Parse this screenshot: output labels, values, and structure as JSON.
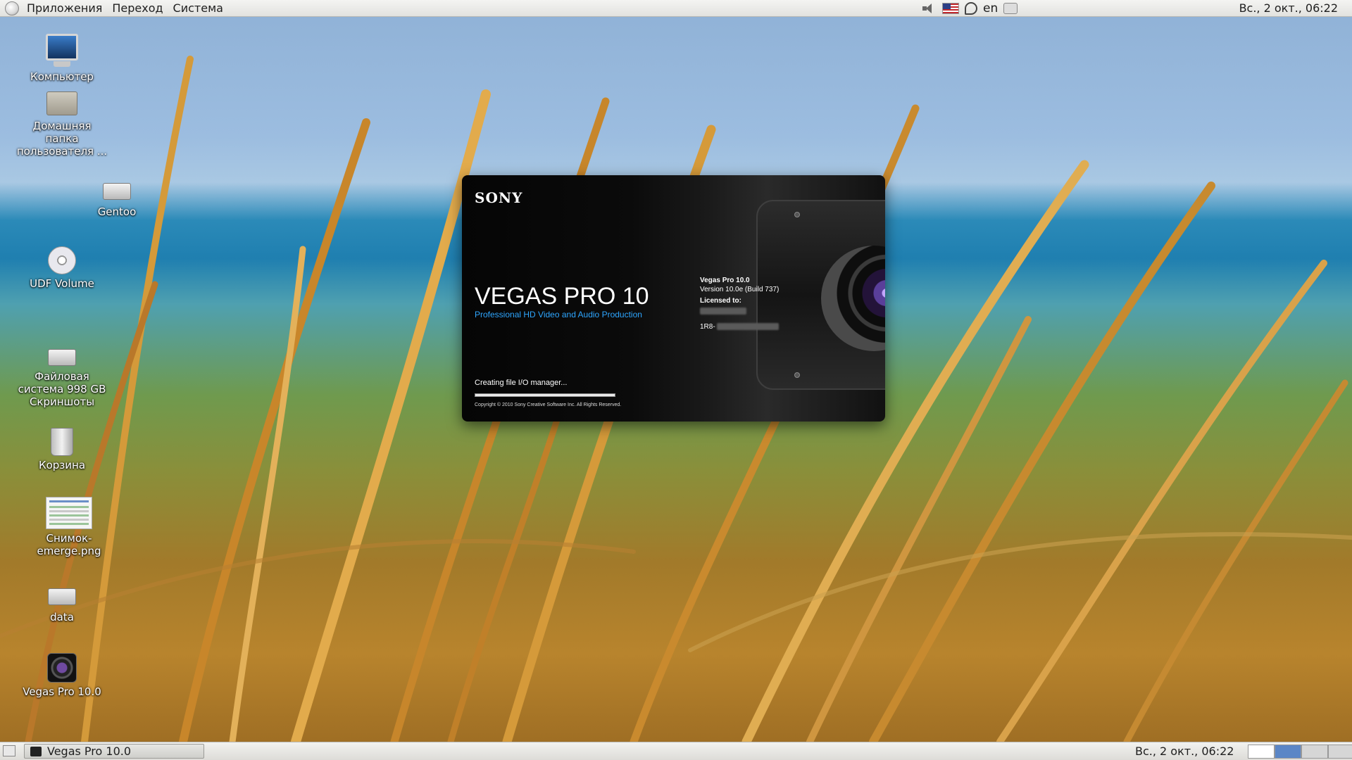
{
  "top_panel": {
    "menu": [
      "Приложения",
      "Переход",
      "Система"
    ],
    "tray": {
      "lang": "en",
      "speaker_icon": "speaker-icon",
      "flag_icon": "us-flag-icon"
    },
    "clock": "Вс.,  2 окт., 06:22"
  },
  "desktop_icons": [
    {
      "label": "Компьютер",
      "icon": "computer-icon"
    },
    {
      "label": "Домашняя папка пользователя ...",
      "icon": "home-folder-icon"
    },
    {
      "label": "Gentoo",
      "icon": "drive-icon"
    },
    {
      "label": "UDF Volume",
      "icon": "disc-icon"
    },
    {
      "label": "Файловая система 998 GB Скриншоты",
      "icon": "drive-icon"
    },
    {
      "label": "Корзина",
      "icon": "trash-icon"
    },
    {
      "label": "Снимок-emerge.png",
      "icon": "image-file-icon"
    },
    {
      "label": "data",
      "icon": "drive-icon"
    },
    {
      "label": "Vegas Pro 10.0",
      "icon": "vegas-icon"
    }
  ],
  "splash": {
    "brand": "SONY",
    "product": "VEGAS PRO 10",
    "subtitle": "Professional HD Video and Audio Production",
    "info_title": "Vegas Pro 10.0",
    "info_version": "Version 10.0e (Build 737)",
    "licensed_label": "Licensed to:",
    "serial_prefix": "1R8-",
    "status": "Creating file I/O manager...",
    "progress_percent": 100,
    "copyright": "Copyright © 2010 Sony Creative Software Inc. All Rights Reserved."
  },
  "bottom_panel": {
    "task_label": "Vegas Pro 10.0",
    "clock": "Вс.,  2 окт., 06:22",
    "workspaces": 4,
    "active_workspace": 2
  }
}
